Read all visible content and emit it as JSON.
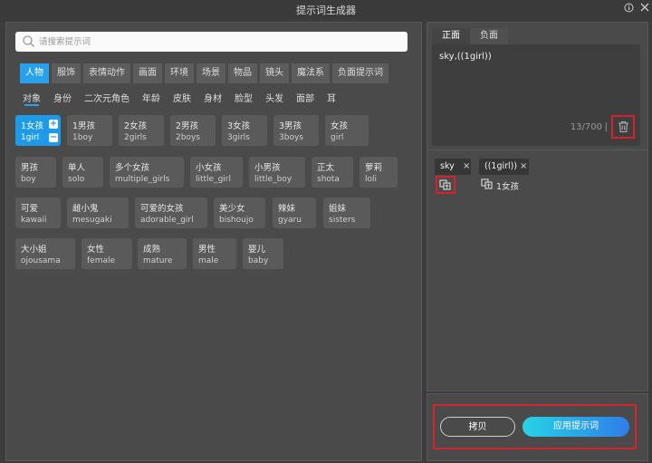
{
  "window": {
    "title": "提示词生成器",
    "help_icon": "help-icon",
    "close_icon": "close-icon"
  },
  "search": {
    "placeholder": "请搜索提示词",
    "icon": "search-icon"
  },
  "category_tabs": [
    "人物",
    "服饰",
    "表情动作",
    "画面",
    "环境",
    "场景",
    "物品",
    "镜头",
    "魔法系",
    "负面提示词"
  ],
  "active_category": "人物",
  "sub_tabs": [
    "对象",
    "身份",
    "二次元角色",
    "年龄",
    "皮肤",
    "身材",
    "脸型",
    "头发",
    "面部",
    "耳"
  ],
  "active_sub_tab": "对象",
  "tags": [
    [
      {
        "zh": "1女孩",
        "en": "1girl"
      },
      {
        "zh": "1男孩",
        "en": "1boy"
      },
      {
        "zh": "2女孩",
        "en": "2girls"
      },
      {
        "zh": "2男孩",
        "en": "2boys"
      },
      {
        "zh": "3女孩",
        "en": "3girls"
      },
      {
        "zh": "3男孩",
        "en": "3boys"
      },
      {
        "zh": "女孩",
        "en": "girl"
      }
    ],
    [
      {
        "zh": "男孩",
        "en": "boy"
      },
      {
        "zh": "单人",
        "en": "solo"
      },
      {
        "zh": "多个女孩",
        "en": "multiple_girls"
      },
      {
        "zh": "小女孩",
        "en": "little_girl"
      },
      {
        "zh": "小男孩",
        "en": "little_boy"
      },
      {
        "zh": "正太",
        "en": "shota"
      },
      {
        "zh": "萝莉",
        "en": "loli"
      }
    ],
    [
      {
        "zh": "可爱",
        "en": "kawaii"
      },
      {
        "zh": "雌小鬼",
        "en": "mesugaki"
      },
      {
        "zh": "可爱的女孩",
        "en": "adorable_girl"
      },
      {
        "zh": "美少女",
        "en": "bishoujo"
      },
      {
        "zh": "辣妹",
        "en": "gyaru"
      },
      {
        "zh": "姐妹",
        "en": "sisters"
      }
    ],
    [
      {
        "zh": "大小姐",
        "en": "ojousama"
      },
      {
        "zh": "女性",
        "en": "female"
      },
      {
        "zh": "成熟",
        "en": "mature"
      },
      {
        "zh": "男性",
        "en": "male"
      },
      {
        "zh": "婴儿",
        "en": "baby"
      }
    ]
  ],
  "active_tag_controls": {
    "plus": "+",
    "minus": "−"
  },
  "prompt_tabs": [
    "正面",
    "负面"
  ],
  "active_prompt_tab": "正面",
  "prompt": {
    "text": "sky,((1girl))",
    "count": "13/700",
    "separator": "|",
    "delete_icon": "trash-icon"
  },
  "chips": [
    {
      "label": "sky",
      "close": "×",
      "translate_icon": "translate-icon"
    },
    {
      "label": "((1girl))",
      "close": "×",
      "translate_icon": "translate-icon",
      "translation": "1女孩"
    }
  ],
  "buttons": {
    "copy": "拷贝",
    "apply": "应用提示词"
  },
  "colors": {
    "accent": "#1e9be8",
    "highlight_box": "#d4232e",
    "panel": "#4a4a4a",
    "background": "#3c3c3c"
  }
}
